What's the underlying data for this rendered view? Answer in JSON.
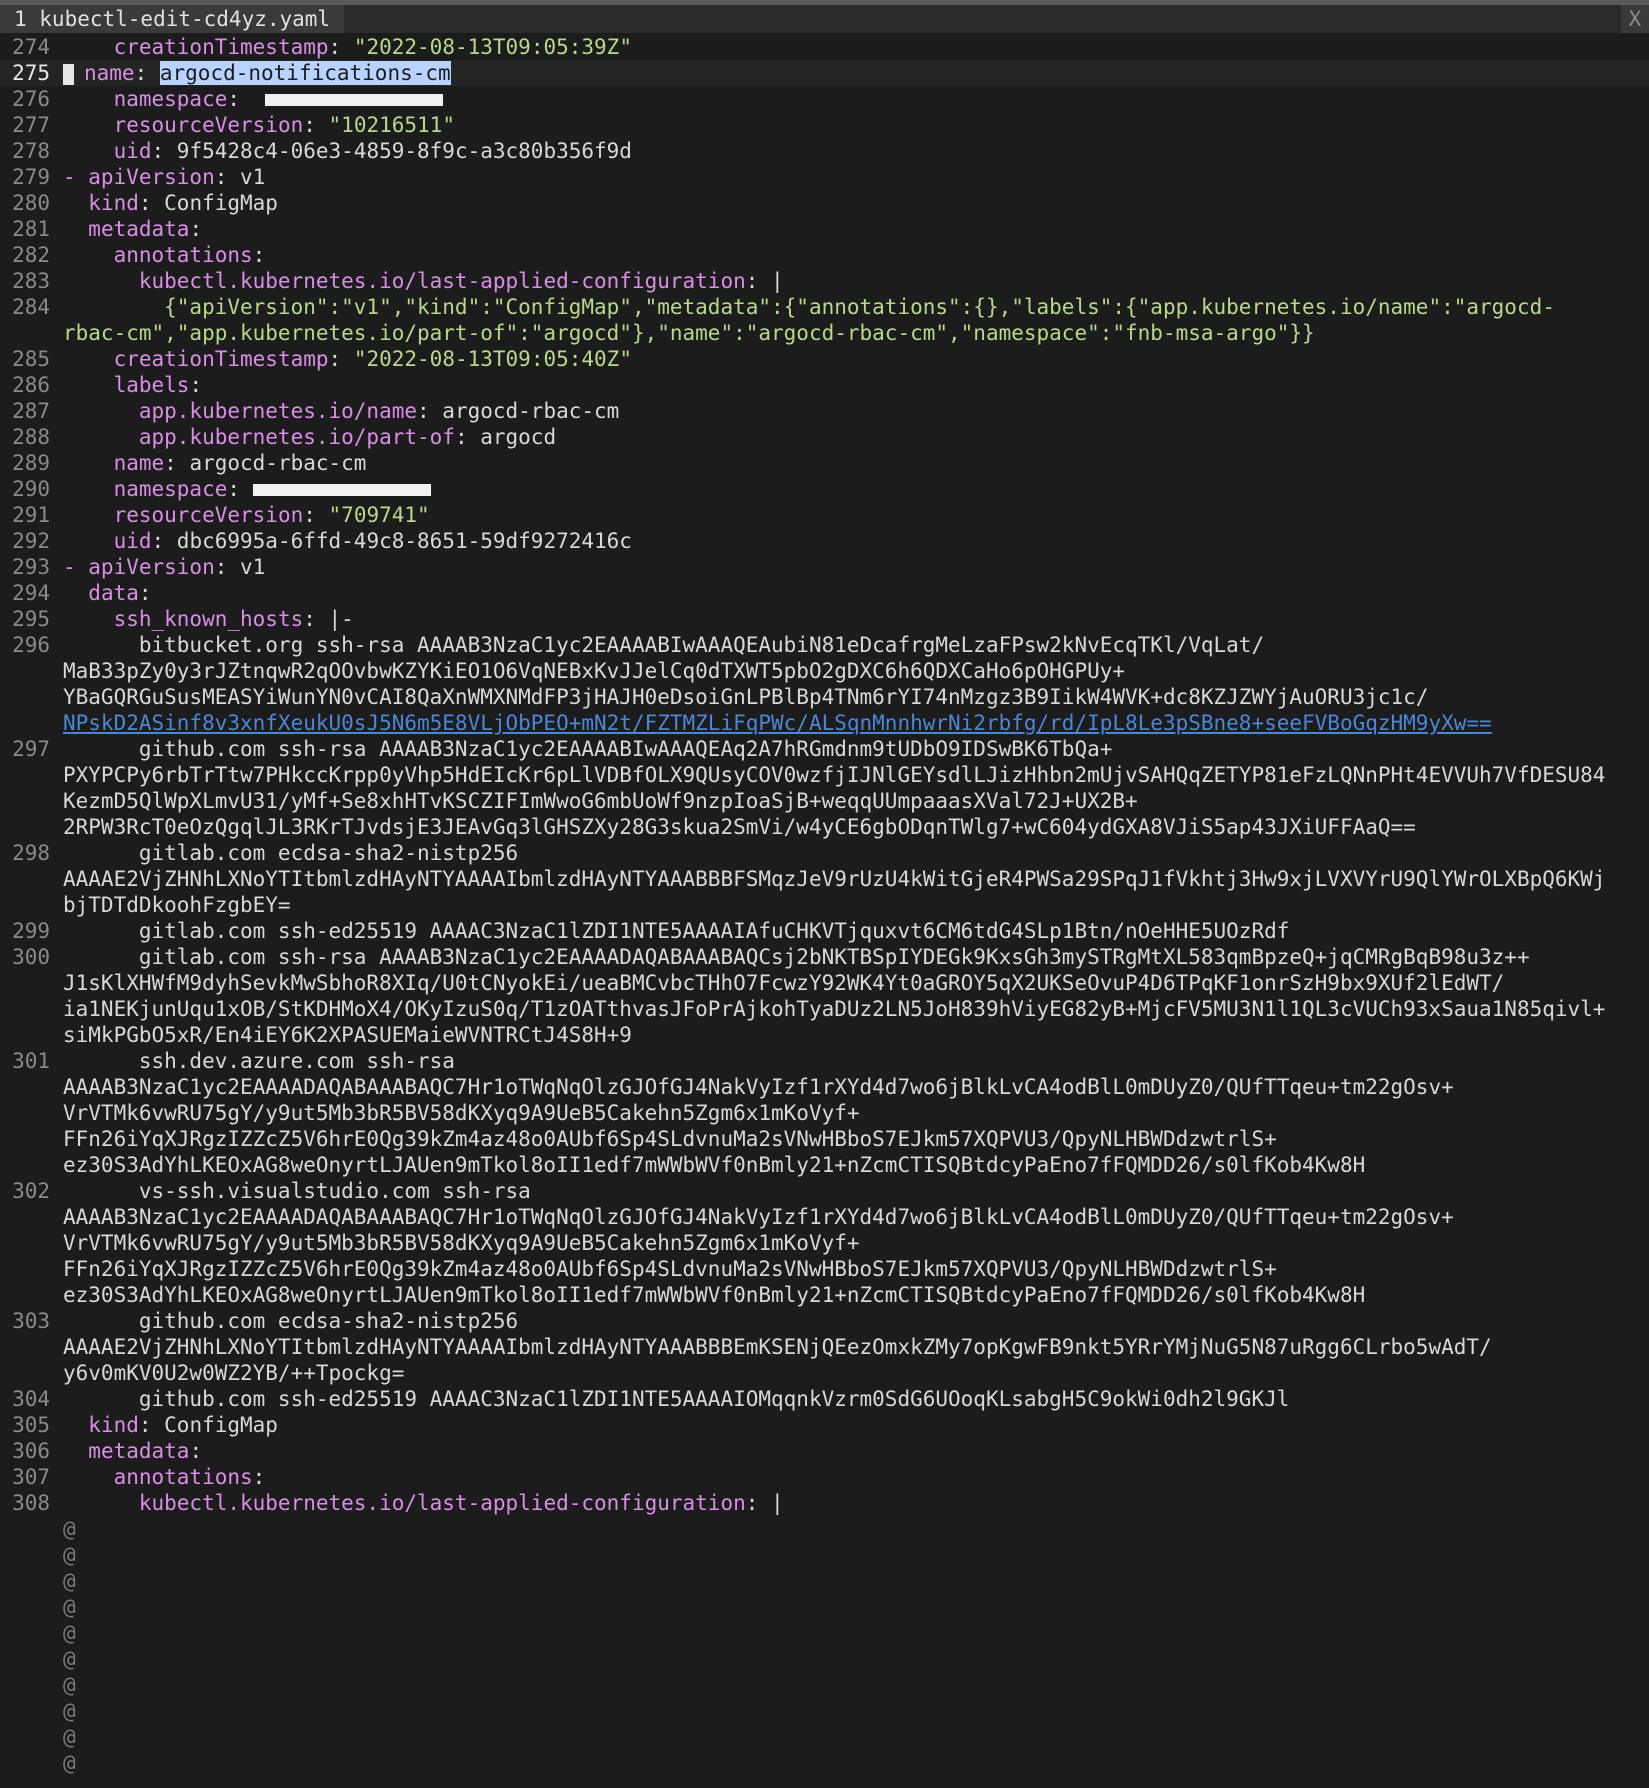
{
  "tab": {
    "label": "1 kubectl-edit-cd4yz.yaml",
    "close": "X"
  },
  "lines": [
    {
      "n": "274",
      "parts": [
        [
          "v",
          "    "
        ],
        [
          "k",
          "creationTimestamp"
        ],
        [
          "v",
          ": "
        ],
        [
          "s",
          "\"2022-08-13T09:05:39Z\""
        ]
      ]
    },
    {
      "n": "275",
      "cur": true,
      "parts": [
        [
          "cursor",
          ""
        ],
        [
          "k",
          "name"
        ],
        [
          "v",
          ": "
        ],
        [
          "hl",
          "argocd-notifications-cm"
        ]
      ]
    },
    {
      "n": "276",
      "parts": [
        [
          "v",
          "    "
        ],
        [
          "k",
          "namespace"
        ],
        [
          "v",
          ":  "
        ],
        [
          "redact",
          ""
        ]
      ]
    },
    {
      "n": "277",
      "parts": [
        [
          "v",
          "    "
        ],
        [
          "k",
          "resourceVersion"
        ],
        [
          "v",
          ": "
        ],
        [
          "s",
          "\"10216511\""
        ]
      ]
    },
    {
      "n": "278",
      "parts": [
        [
          "v",
          "    "
        ],
        [
          "k",
          "uid"
        ],
        [
          "v",
          ": 9f5428c4-06e3-4859-8f9c-a3c80b356f9d"
        ]
      ]
    },
    {
      "n": "279",
      "parts": [
        [
          "k",
          "- apiVersion"
        ],
        [
          "v",
          ": v1"
        ]
      ]
    },
    {
      "n": "280",
      "parts": [
        [
          "v",
          "  "
        ],
        [
          "k",
          "kind"
        ],
        [
          "v",
          ": ConfigMap"
        ]
      ]
    },
    {
      "n": "281",
      "parts": [
        [
          "v",
          "  "
        ],
        [
          "k",
          "metadata"
        ],
        [
          "v",
          ":"
        ]
      ]
    },
    {
      "n": "282",
      "parts": [
        [
          "v",
          "    "
        ],
        [
          "k",
          "annotations"
        ],
        [
          "v",
          ":"
        ]
      ]
    },
    {
      "n": "283",
      "parts": [
        [
          "v",
          "      "
        ],
        [
          "k",
          "kubectl.kubernetes.io/last-applied-configuration"
        ],
        [
          "v",
          ": |"
        ]
      ]
    },
    {
      "n": "284",
      "parts": [
        [
          "s",
          "        {\"apiVersion\":\"v1\",\"kind\":\"ConfigMap\",\"metadata\":{\"annotations\":{},\"labels\":{\"app.kubernetes.io/name\":\"argocd-"
        ]
      ]
    },
    {
      "c": true,
      "parts": [
        [
          "s",
          "rbac-cm\",\"app.kubernetes.io/part-of\":\"argocd\"},\"name\":\"argocd-rbac-cm\",\"namespace\":\"fnb-msa-argo\"}}"
        ]
      ]
    },
    {
      "n": "285",
      "parts": [
        [
          "v",
          "    "
        ],
        [
          "k",
          "creationTimestamp"
        ],
        [
          "v",
          ": "
        ],
        [
          "s",
          "\"2022-08-13T09:05:40Z\""
        ]
      ]
    },
    {
      "n": "286",
      "parts": [
        [
          "v",
          "    "
        ],
        [
          "k",
          "labels"
        ],
        [
          "v",
          ":"
        ]
      ]
    },
    {
      "n": "287",
      "parts": [
        [
          "v",
          "      "
        ],
        [
          "k",
          "app.kubernetes.io/name"
        ],
        [
          "v",
          ": argocd-rbac-cm"
        ]
      ]
    },
    {
      "n": "288",
      "parts": [
        [
          "v",
          "      "
        ],
        [
          "k",
          "app.kubernetes.io/part-of"
        ],
        [
          "v",
          ": argocd"
        ]
      ]
    },
    {
      "n": "289",
      "parts": [
        [
          "v",
          "    "
        ],
        [
          "k",
          "name"
        ],
        [
          "v",
          ": argocd-rbac-cm"
        ]
      ]
    },
    {
      "n": "290",
      "parts": [
        [
          "v",
          "    "
        ],
        [
          "k",
          "namespace"
        ],
        [
          "v",
          ": "
        ],
        [
          "redact",
          ""
        ]
      ]
    },
    {
      "n": "291",
      "parts": [
        [
          "v",
          "    "
        ],
        [
          "k",
          "resourceVersion"
        ],
        [
          "v",
          ": "
        ],
        [
          "s",
          "\"709741\""
        ]
      ]
    },
    {
      "n": "292",
      "parts": [
        [
          "v",
          "    "
        ],
        [
          "k",
          "uid"
        ],
        [
          "v",
          ": dbc6995a-6ffd-49c8-8651-59df9272416c"
        ]
      ]
    },
    {
      "n": "293",
      "parts": [
        [
          "k",
          "- apiVersion"
        ],
        [
          "v",
          ": v1"
        ]
      ]
    },
    {
      "n": "294",
      "parts": [
        [
          "v",
          "  "
        ],
        [
          "k",
          "data"
        ],
        [
          "v",
          ":"
        ]
      ]
    },
    {
      "n": "295",
      "parts": [
        [
          "v",
          "    "
        ],
        [
          "k",
          "ssh_known_hosts"
        ],
        [
          "v",
          ": |-"
        ]
      ]
    },
    {
      "n": "296",
      "parts": [
        [
          "v",
          "      bitbucket.org ssh-rsa AAAAB3NzaC1yc2EAAAABIwAAAQEAubiN81eDcafrgMeLzaFPsw2kNvEcqTKl/VqLat/"
        ]
      ]
    },
    {
      "c": true,
      "parts": [
        [
          "v",
          "MaB33pZy0y3rJZtnqwR2qOOvbwKZYKiEO1O6VqNEBxKvJJelCq0dTXWT5pbO2gDXC6h6QDXCaHo6pOHGPUy+"
        ]
      ]
    },
    {
      "c": true,
      "parts": [
        [
          "v",
          "YBaGQRGuSusMEASYiWunYN0vCAI8QaXnWMXNMdFP3jHAJH0eDsoiGnLPBlBp4TNm6rYI74nMzgz3B9IikW4WVK+dc8KZJZWYjAuORU3jc1c/"
        ]
      ]
    },
    {
      "c": true,
      "parts": [
        [
          "link",
          "NPskD2ASinf8v3xnfXeukU0sJ5N6m5E8VLjObPEO+mN2t/FZTMZLiFqPWc/ALSqnMnnhwrNi2rbfg/rd/IpL8Le3pSBne8+seeFVBoGqzHM9yXw=="
        ]
      ]
    },
    {
      "n": "297",
      "parts": [
        [
          "v",
          "      github.com ssh-rsa AAAAB3NzaC1yc2EAAAABIwAAAQEAq2A7hRGmdnm9tUDbO9IDSwBK6TbQa+"
        ]
      ]
    },
    {
      "c": true,
      "parts": [
        [
          "v",
          "PXYPCPy6rbTrTtw7PHkccKrpp0yVhp5HdEIcKr6pLlVDBfOLX9QUsyCOV0wzfjIJNlGEYsdlLJizHhbn2mUjvSAHQqZETYP81eFzLQNnPHt4EVVUh7VfDESU84"
        ]
      ]
    },
    {
      "c": true,
      "parts": [
        [
          "v",
          "KezmD5QlWpXLmvU31/yMf+Se8xhHTvKSCZIFImWwoG6mbUoWf9nzpIoaSjB+weqqUUmpaaasXVal72J+UX2B+"
        ]
      ]
    },
    {
      "c": true,
      "parts": [
        [
          "v",
          "2RPW3RcT0eOzQgqlJL3RKrTJvdsjE3JEAvGq3lGHSZXy28G3skua2SmVi/w4yCE6gbODqnTWlg7+wC604ydGXA8VJiS5ap43JXiUFFAaQ=="
        ]
      ]
    },
    {
      "n": "298",
      "parts": [
        [
          "v",
          "      gitlab.com ecdsa-sha2-nistp256"
        ]
      ]
    },
    {
      "c": true,
      "parts": [
        [
          "v",
          "AAAAE2VjZHNhLXNoYTItbmlzdHAyNTYAAAAIbmlzdHAyNTYAAABBBFSMqzJeV9rUzU4kWitGjeR4PWSa29SPqJ1fVkhtj3Hw9xjLVXVYrU9QlYWrOLXBpQ6KWj"
        ]
      ]
    },
    {
      "c": true,
      "parts": [
        [
          "v",
          "bjTDTdDkoohFzgbEY="
        ]
      ]
    },
    {
      "n": "299",
      "parts": [
        [
          "v",
          "      gitlab.com ssh-ed25519 AAAAC3NzaC1lZDI1NTE5AAAAIAfuCHKVTjquxvt6CM6tdG4SLp1Btn/nOeHHE5UOzRdf"
        ]
      ]
    },
    {
      "n": "300",
      "parts": [
        [
          "v",
          "      gitlab.com ssh-rsa AAAAB3NzaC1yc2EAAAADAQABAAABAQCsj2bNKTBSpIYDEGk9KxsGh3mySTRgMtXL583qmBpzeQ+jqCMRgBqB98u3z++"
        ]
      ]
    },
    {
      "c": true,
      "parts": [
        [
          "v",
          "J1sKlXHWfM9dyhSevkMwSbhoR8XIq/U0tCNyokEi/ueaBMCvbcTHhO7FcwzY92WK4Yt0aGROY5qX2UKSeOvuP4D6TPqKF1onrSzH9bx9XUf2lEdWT/"
        ]
      ]
    },
    {
      "c": true,
      "parts": [
        [
          "v",
          "ia1NEKjunUqu1xOB/StKDHMoX4/OKyIzuS0q/T1zOATthvasJFoPrAjkohTyaDUz2LN5JoH839hViyEG82yB+MjcFV5MU3N1l1QL3cVUCh93xSaua1N85qivl+"
        ]
      ]
    },
    {
      "c": true,
      "parts": [
        [
          "v",
          "siMkPGbO5xR/En4iEY6K2XPASUEMaieWVNTRCtJ4S8H+9"
        ]
      ]
    },
    {
      "n": "301",
      "parts": [
        [
          "v",
          "      ssh.dev.azure.com ssh-rsa"
        ]
      ]
    },
    {
      "c": true,
      "parts": [
        [
          "v",
          "AAAAB3NzaC1yc2EAAAADAQABAAABAQC7Hr1oTWqNqOlzGJOfGJ4NakVyIzf1rXYd4d7wo6jBlkLvCA4odBlL0mDUyZ0/QUfTTqeu+tm22gOsv+"
        ]
      ]
    },
    {
      "c": true,
      "parts": [
        [
          "v",
          "VrVTMk6vwRU75gY/y9ut5Mb3bR5BV58dKXyq9A9UeB5Cakehn5Zgm6x1mKoVyf+"
        ]
      ]
    },
    {
      "c": true,
      "parts": [
        [
          "v",
          "FFn26iYqXJRgzIZZcZ5V6hrE0Qg39kZm4az48o0AUbf6Sp4SLdvnuMa2sVNwHBboS7EJkm57XQPVU3/QpyNLHBWDdzwtrlS+"
        ]
      ]
    },
    {
      "c": true,
      "parts": [
        [
          "v",
          "ez30S3AdYhLKEOxAG8weOnyrtLJAUen9mTkol8oII1edf7mWWbWVf0nBmly21+nZcmCTISQBtdcyPaEno7fFQMDD26/s0lfKob4Kw8H"
        ]
      ]
    },
    {
      "n": "302",
      "parts": [
        [
          "v",
          "      vs-ssh.visualstudio.com ssh-rsa"
        ]
      ]
    },
    {
      "c": true,
      "parts": [
        [
          "v",
          "AAAAB3NzaC1yc2EAAAADAQABAAABAQC7Hr1oTWqNqOlzGJOfGJ4NakVyIzf1rXYd4d7wo6jBlkLvCA4odBlL0mDUyZ0/QUfTTqeu+tm22gOsv+"
        ]
      ]
    },
    {
      "c": true,
      "parts": [
        [
          "v",
          "VrVTMk6vwRU75gY/y9ut5Mb3bR5BV58dKXyq9A9UeB5Cakehn5Zgm6x1mKoVyf+"
        ]
      ]
    },
    {
      "c": true,
      "parts": [
        [
          "v",
          "FFn26iYqXJRgzIZZcZ5V6hrE0Qg39kZm4az48o0AUbf6Sp4SLdvnuMa2sVNwHBboS7EJkm57XQPVU3/QpyNLHBWDdzwtrlS+"
        ]
      ]
    },
    {
      "c": true,
      "parts": [
        [
          "v",
          "ez30S3AdYhLKEOxAG8weOnyrtLJAUen9mTkol8oII1edf7mWWbWVf0nBmly21+nZcmCTISQBtdcyPaEno7fFQMDD26/s0lfKob4Kw8H"
        ]
      ]
    },
    {
      "n": "303",
      "parts": [
        [
          "v",
          "      github.com ecdsa-sha2-nistp256"
        ]
      ]
    },
    {
      "c": true,
      "parts": [
        [
          "v",
          "AAAAE2VjZHNhLXNoYTItbmlzdHAyNTYAAAAIbmlzdHAyNTYAAABBBEmKSENjQEezOmxkZMy7opKgwFB9nkt5YRrYMjNuG5N87uRgg6CLrbo5wAdT/"
        ]
      ]
    },
    {
      "c": true,
      "parts": [
        [
          "v",
          "y6v0mKV0U2w0WZ2YB/++Tpockg="
        ]
      ]
    },
    {
      "n": "304",
      "parts": [
        [
          "v",
          "      github.com ssh-ed25519 AAAAC3NzaC1lZDI1NTE5AAAAIOMqqnkVzrm0SdG6UOoqKLsabgH5C9okWi0dh2l9GKJl"
        ]
      ]
    },
    {
      "n": "305",
      "parts": [
        [
          "v",
          "  "
        ],
        [
          "k",
          "kind"
        ],
        [
          "v",
          ": ConfigMap"
        ]
      ]
    },
    {
      "n": "306",
      "parts": [
        [
          "v",
          "  "
        ],
        [
          "k",
          "metadata"
        ],
        [
          "v",
          ":"
        ]
      ]
    },
    {
      "n": "307",
      "parts": [
        [
          "v",
          "    "
        ],
        [
          "k",
          "annotations"
        ],
        [
          "v",
          ":"
        ]
      ]
    },
    {
      "n": "308",
      "parts": [
        [
          "v",
          "      "
        ],
        [
          "k",
          "kubectl.kubernetes.io/last-applied-configuration"
        ],
        [
          "v",
          ": |"
        ]
      ]
    }
  ],
  "filler": [
    "@",
    "@",
    "@",
    "@",
    "@",
    "@",
    "@",
    "@",
    "@",
    "@"
  ]
}
